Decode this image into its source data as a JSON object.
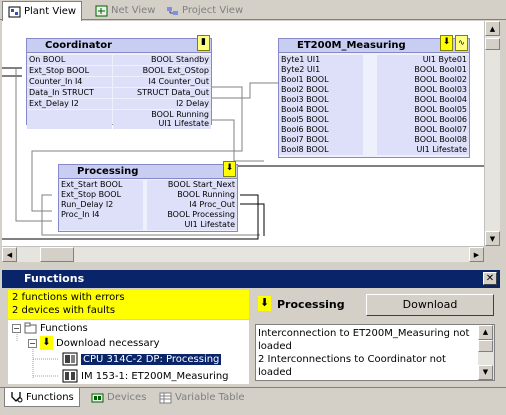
{
  "top_tabs": [
    {
      "label": "Plant View",
      "icon": "plant-view-icon",
      "active": true
    },
    {
      "label": "Net View",
      "icon": "net-view-icon",
      "active": false
    },
    {
      "label": "Project View",
      "icon": "project-view-icon",
      "active": false
    }
  ],
  "blocks": {
    "coordinator": {
      "title": "Coordinator",
      "rows": [
        {
          "l": "On BOOL",
          "r": "BOOL Standby"
        },
        {
          "l": "Ext_Stop BOOL",
          "r": "BOOL Ext_OStop"
        },
        {
          "l": "Counter_In I4",
          "r": "I4 Counter_Out"
        },
        {
          "l": "Data_In STRUCT",
          "r": "STRUCT Data_Out"
        },
        {
          "l": "Ext_Delay I2",
          "r": "I2 Delay"
        },
        {
          "l": "",
          "r": "BOOL Running"
        },
        {
          "l": "",
          "r": "UI1 Lifestate"
        }
      ]
    },
    "et200m": {
      "title": "ET200M_Measuring",
      "rows": [
        {
          "l": "Byte1 UI1",
          "r": "UI1 Byte01"
        },
        {
          "l": "Byte2 UI1",
          "r": "BOOL Bool01"
        },
        {
          "l": "Bool1 BOOL",
          "r": "BOOL Bool02"
        },
        {
          "l": "Bool2 BOOL",
          "r": "BOOL Bool03"
        },
        {
          "l": "Bool3 BOOL",
          "r": "BOOL Bool04"
        },
        {
          "l": "Bool4 BOOL",
          "r": "BOOL Bool05"
        },
        {
          "l": "Bool5 BOOL",
          "r": "BOOL Bool06"
        },
        {
          "l": "Bool6 BOOL",
          "r": "BOOL Bool07"
        },
        {
          "l": "Bool7 BOOL",
          "r": "BOOL Bool08"
        },
        {
          "l": "Bool8 BOOL",
          "r": "UI1 Lifestate"
        }
      ]
    },
    "processing": {
      "title": "Processing",
      "rows": [
        {
          "l": "Ext_Start BOOL",
          "r": "BOOL Start_Next"
        },
        {
          "l": "Ext_Stop BOOL",
          "r": "BOOL Running"
        },
        {
          "l": "Run_Delay I2",
          "r": "I4 Proc_Out"
        },
        {
          "l": "Proc_In I4",
          "r": "BOOL Processing"
        },
        {
          "l": "",
          "r": "UI1 Lifestate"
        }
      ]
    }
  },
  "functions_panel": {
    "title": "Functions",
    "error_lines": [
      "2 functions with errors",
      "2 devices with faults"
    ],
    "tree": {
      "root": "Functions",
      "child": "Download necessary",
      "items": [
        {
          "label": "CPU 314C-2 DP: Processing",
          "selected": true
        },
        {
          "label": "IM 153-1: ET200M_Measuring",
          "selected": false
        }
      ]
    },
    "selected_title": "Processing",
    "download_label": "Download",
    "messages": [
      "Interconnection to ET200M_Measuring not loaded",
      "2 Interconnections to Coordinator not loaded"
    ]
  },
  "bottom_tabs": [
    {
      "label": "Functions",
      "icon": "functions-icon",
      "active": true
    },
    {
      "label": "Devices",
      "icon": "devices-icon",
      "active": false
    },
    {
      "label": "Variable Table",
      "icon": "variable-table-icon",
      "active": false
    }
  ],
  "colors": {
    "block_fill": "#eef0fc",
    "block_title": "#c8cdf2",
    "panel_header": "#0a246a",
    "error_bg": "#ffff00",
    "selection": "#0a246a"
  }
}
